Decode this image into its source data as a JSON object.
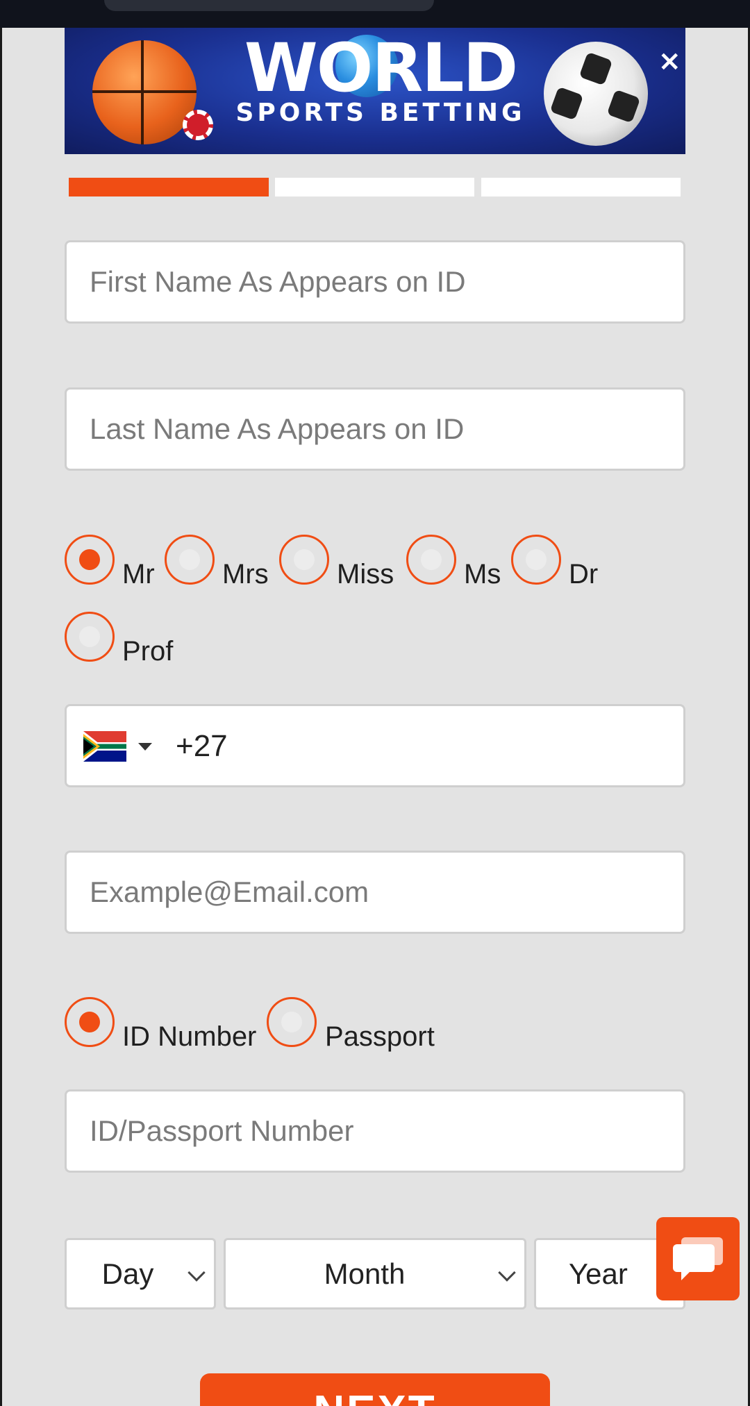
{
  "banner": {
    "logo_main": "WORLD",
    "logo_sub": "SPORTS BETTING",
    "close_glyph": "×"
  },
  "progress": {
    "current_step": 1,
    "total_steps": 3
  },
  "form": {
    "first_name_placeholder": "First Name As Appears on ID",
    "last_name_placeholder": "Last Name As Appears on ID",
    "titles": [
      {
        "label": "Mr",
        "checked": true
      },
      {
        "label": "Mrs",
        "checked": false
      },
      {
        "label": "Miss",
        "checked": false
      },
      {
        "label": "Ms",
        "checked": false
      },
      {
        "label": "Dr",
        "checked": false
      },
      {
        "label": "Prof",
        "checked": false
      }
    ],
    "phone": {
      "country_flag": "south-africa-flag-icon",
      "dial_code": "+27"
    },
    "email_placeholder": "Example@Email.com",
    "id_types": [
      {
        "label": "ID Number",
        "checked": true
      },
      {
        "label": "Passport",
        "checked": false
      }
    ],
    "id_number_placeholder": "ID/Passport Number",
    "dob": {
      "day_label": "Day",
      "month_label": "Month",
      "year_label": "Year"
    },
    "next_label": "NEXT"
  },
  "chat": {
    "icon": "chat-bubble-icon"
  },
  "colors": {
    "accent": "#f04d14",
    "background": "#e3e3e3",
    "field_bg": "#ffffff"
  }
}
